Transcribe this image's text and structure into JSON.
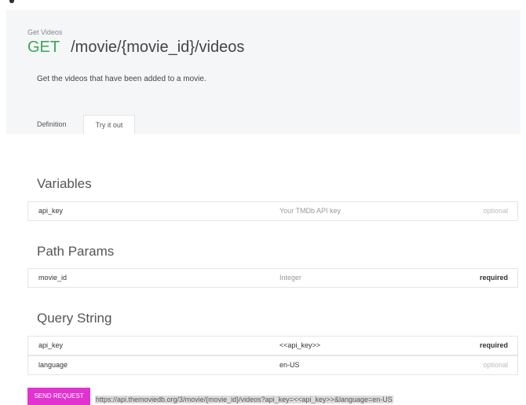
{
  "breadcrumb": "Get Videos",
  "endpoint": {
    "method": "GET",
    "path": "/movie/{movie_id}/videos"
  },
  "description": "Get the videos that have been added to a movie.",
  "tabs": [
    {
      "label": "Definition"
    },
    {
      "label": "Try it out"
    }
  ],
  "sections": {
    "variables": {
      "title": "Variables",
      "rows": [
        {
          "name": "api_key",
          "value": "Your TMDb API key",
          "requirement": "optional"
        }
      ]
    },
    "path_params": {
      "title": "Path Params",
      "rows": [
        {
          "name": "movie_id",
          "value": "Integer",
          "requirement": "required"
        }
      ]
    },
    "query_string": {
      "title": "Query String",
      "rows": [
        {
          "name": "api_key",
          "value": "<<api_key>>",
          "requirement": "required"
        },
        {
          "name": "language",
          "value": "en-US",
          "requirement": "optional"
        }
      ]
    }
  },
  "send_request": {
    "label": "SEND REQUEST",
    "url": "https://api.themoviedb.org/3/movie/{movie_id}/videos?api_key=<<api_key>>&language=en-US"
  },
  "colors": {
    "method_get": "#3aa757",
    "send_button": "#e233d0",
    "header_bg": "#f5f6f8"
  }
}
